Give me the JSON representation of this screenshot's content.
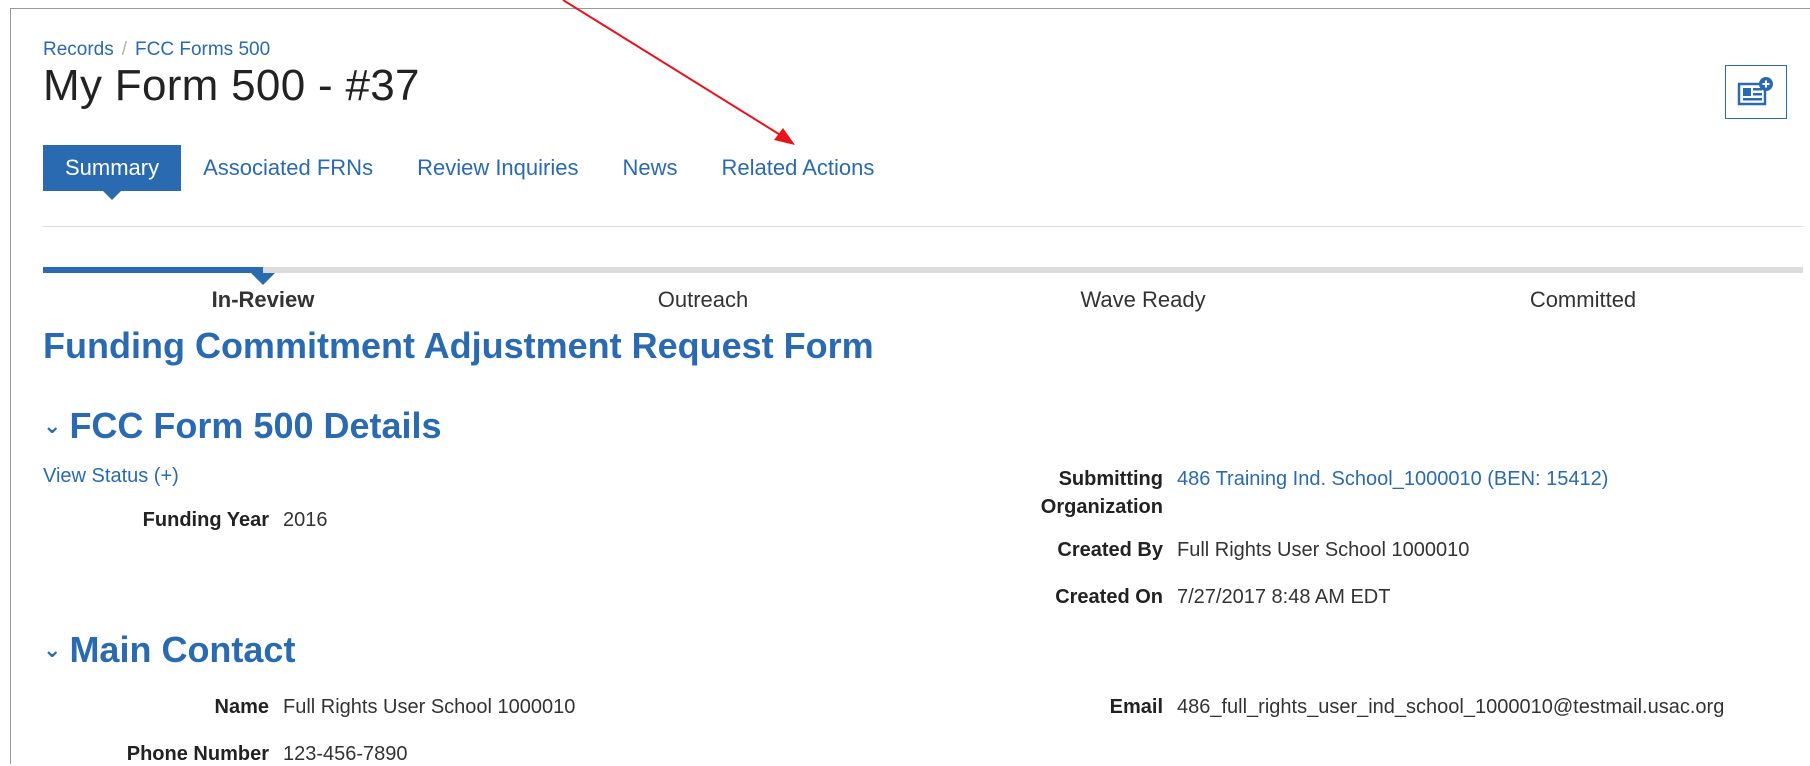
{
  "breadcrumb": {
    "root": "Records",
    "separator": "/",
    "current": "FCC Forms 500"
  },
  "page": {
    "title": "My Form 500 - #37"
  },
  "widget_button": {
    "icon": "newspaper-add-icon"
  },
  "tabs": [
    {
      "label": "Summary",
      "active": true
    },
    {
      "label": "Associated FRNs",
      "active": false
    },
    {
      "label": "Review Inquiries",
      "active": false
    },
    {
      "label": "News",
      "active": false
    },
    {
      "label": "Related Actions",
      "active": false
    }
  ],
  "progress": {
    "steps": [
      "In-Review",
      "Outreach",
      "Wave Ready",
      "Committed"
    ],
    "current_index": 0
  },
  "form_heading": "Funding Commitment Adjustment Request Form",
  "details": {
    "heading": "FCC Form 500 Details",
    "view_status": "View Status (+)",
    "funding_year": {
      "label": "Funding Year",
      "value": "2016"
    },
    "submitting_org": {
      "label_line1": "Submitting",
      "label_line2": "Organization",
      "value": "486 Training Ind. School_1000010 (BEN: 15412)"
    },
    "created_by": {
      "label": "Created By",
      "value": "Full Rights User School 1000010"
    },
    "created_on": {
      "label": "Created On",
      "value": "7/27/2017 8:48 AM EDT"
    }
  },
  "main_contact": {
    "heading": "Main Contact",
    "name": {
      "label": "Name",
      "value": "Full Rights User School 1000010"
    },
    "email": {
      "label": "Email",
      "value": "486_full_rights_user_ind_school_1000010@testmail.usac.org"
    },
    "phone": {
      "label": "Phone Number",
      "value": "123-456-7890"
    }
  },
  "colors": {
    "accent": "#2a6ab0",
    "annotation": "#e8141c",
    "divider": "#dcdcdc"
  }
}
